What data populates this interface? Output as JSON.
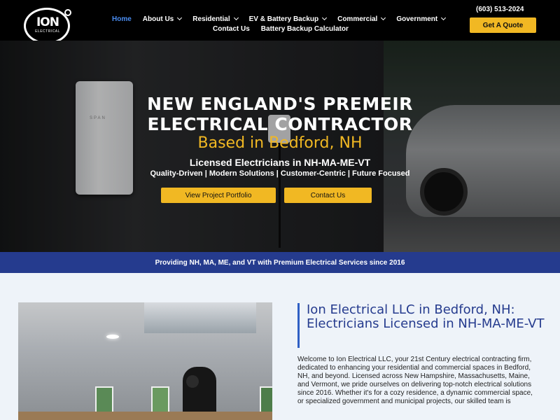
{
  "header": {
    "logo": {
      "main": "ION",
      "sub": "ELECTRICAL"
    },
    "nav_row1": [
      {
        "label": "Home",
        "active": true,
        "dropdown": false
      },
      {
        "label": "About Us",
        "active": false,
        "dropdown": true
      },
      {
        "label": "Residential",
        "active": false,
        "dropdown": true
      },
      {
        "label": "EV & Battery Backup",
        "active": false,
        "dropdown": true
      },
      {
        "label": "Commercial",
        "active": false,
        "dropdown": true
      },
      {
        "label": "Government",
        "active": false,
        "dropdown": true
      }
    ],
    "nav_row2": [
      {
        "label": "Contact Us"
      },
      {
        "label": "Battery Backup Calculator"
      }
    ],
    "phone": "(603) 513-2024",
    "quote_button": "Get A Quote"
  },
  "hero": {
    "panel_label": "SPAN",
    "title_line1": "NEW ENGLAND'S PREMEIR",
    "title_line2": "ELECTRICAL CONTRACTOR",
    "subtitle": "Based in Bedford, NH",
    "licensed": "Licensed Electricians in NH-MA-ME-VT",
    "tagline": "Quality-Driven |   Modern Solutions | Customer-Centric | Future Focused",
    "btn_portfolio": "View Project Portfolio",
    "btn_contact": "Contact Us"
  },
  "banner": {
    "text": "Providing NH, MA, ME, and VT with Premium Electrical Services since 2016"
  },
  "content": {
    "heading": "Ion Electrical LLC in Bedford, NH: Electricians Licensed in NH-MA-ME-VT",
    "paragraph": "Welcome to Ion Electrical LLC, your 21st Century electrical contracting firm, dedicated to enhancing your residential and commercial spaces in Bedford, NH, and beyond. Licensed across New Hampshire, Massachusetts, Maine, and Vermont, we pride ourselves on delivering top-notch electrical solutions since 2016. Whether it's for a cozy residence, a dynamic commercial space, or specialized government and municipal projects, our skilled team is"
  },
  "colors": {
    "accent_yellow": "#f1b823",
    "brand_blue": "#253b8e",
    "nav_active": "#4a8cf0"
  }
}
